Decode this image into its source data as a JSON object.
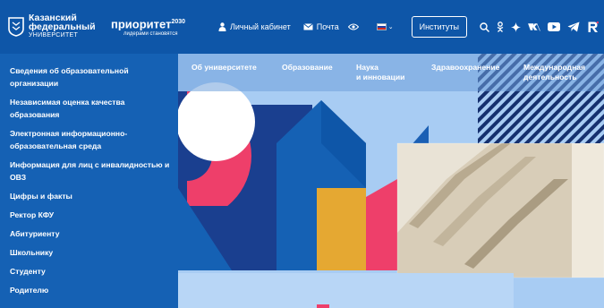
{
  "header": {
    "logo": {
      "line1": "Казанский",
      "line2": "федеральный",
      "line3": "УНИВЕРСИТЕТ"
    },
    "priority": {
      "title": "приоритет",
      "year": "2030",
      "tagline": "лидерами становятся"
    },
    "cabinet_label": "Личный кабинет",
    "mail_label": "Почта",
    "institutes_label": "Институты",
    "flag_colors": [
      "#ffffff",
      "#1c3fa8",
      "#d52b1e"
    ],
    "icons": [
      "accessibility-eye-icon",
      "search-icon",
      "odnoklassniki-icon",
      "sparkle-icon",
      "vk-icon",
      "youtube-icon",
      "telegram-icon",
      "rutube-icon"
    ]
  },
  "sidebar": {
    "items": [
      "Сведения об образовательной организации",
      "Независимая оценка качества образования",
      "Электронная информационно-образовательная среда",
      "Информация для лиц с инвалидностью и ОВЗ",
      "Цифры и факты",
      "Ректор КФУ",
      "Абитуриенту",
      "Школьнику",
      "Студенту",
      "Родителю"
    ]
  },
  "nav": {
    "items": [
      "Об университете",
      "Образование",
      "Наука\nи инновации",
      "Здравоохранение",
      "Международная\nдеятельность"
    ]
  },
  "colors": {
    "header_bg": "#0e56a8",
    "sidebar_bg": "#1561b4",
    "accent_pink": "#ee3f6a",
    "accent_yellow": "#e5a832",
    "navy": "#1a3f8f",
    "sky": "#a8ccf3"
  }
}
